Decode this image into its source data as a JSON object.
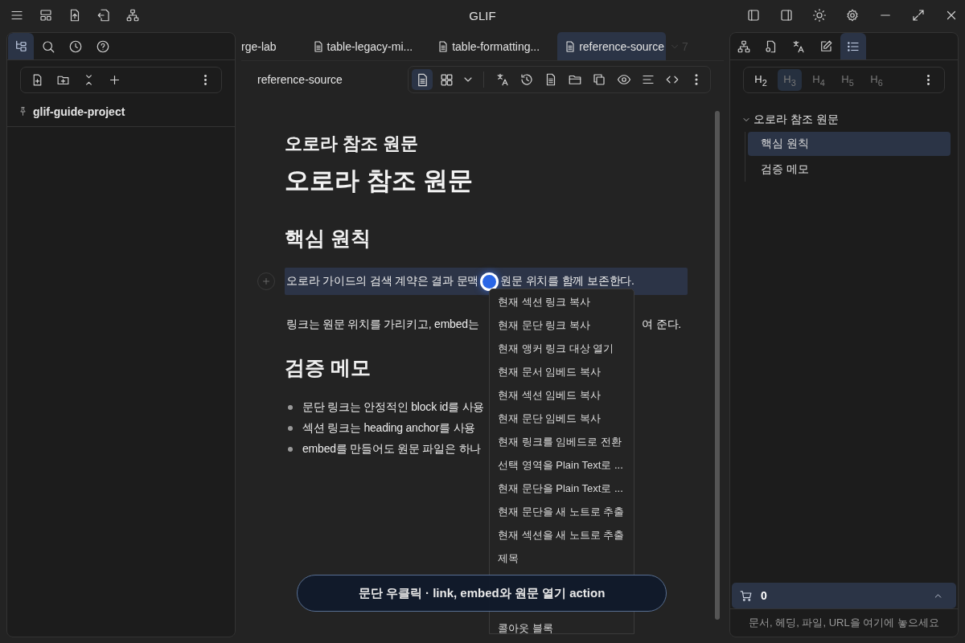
{
  "window": {
    "title": "GLIF"
  },
  "left_panel": {
    "tabs": [
      {
        "kind": "files",
        "selected": true
      },
      {
        "kind": "search",
        "selected": false
      },
      {
        "kind": "history",
        "selected": false
      },
      {
        "kind": "help",
        "selected": false
      }
    ],
    "project": "glif-guide-project"
  },
  "editor": {
    "tabs": [
      {
        "kind": "plain",
        "label": "rge-lab",
        "selected": false
      },
      {
        "kind": "document",
        "label": "table-legacy-mi...",
        "selected": false
      },
      {
        "kind": "document",
        "label": "table-formatting...",
        "selected": false
      },
      {
        "kind": "document",
        "label": "reference-source",
        "selected": true
      }
    ],
    "tab_count": "7",
    "doc_title": "reference-source",
    "view_modes": [
      {
        "kind": "document",
        "selected": true
      },
      {
        "kind": "grid",
        "selected": false
      }
    ],
    "blocks": [
      {
        "kind": "title",
        "text": "오로라 참조 원문"
      },
      {
        "kind": "h1",
        "text": "오로라 참조 원문"
      },
      {
        "kind": "h2",
        "text": "핵심 원칙"
      },
      {
        "kind": "paragraph",
        "text": "오로라 가이드의 검색 계약은 결과 문맥",
        "text_after": "원문 위치를 함께 보존한다.",
        "selected": true
      },
      {
        "kind": "split",
        "text": "링크는 원문 위치를 가리키고, embed는",
        "text_after": "여 준다."
      },
      {
        "kind": "h2",
        "text": "검증 메모"
      },
      {
        "kind": "list",
        "items": [
          "문단 링크는 안정적인 block id를 사용",
          "섹션 링크는 heading anchor를 사용",
          "embed를 만들어도 원문 파일은 하나"
        ]
      }
    ],
    "context_menu": [
      "현재 섹션 링크 복사",
      "현재 문단 링크 복사",
      "현재 앵커 링크 대상 열기",
      "현재 문서 임베드 복사",
      "현재 섹션 임베드 복사",
      "현재 문단 임베드 복사",
      "현재 링크를 임베드로 전환",
      "선택 영역을 Plain Text로 ...",
      "현재 문단을 Plain Text로 ...",
      "현재 문단을 새 노트로 추출",
      "현재 섹션을 새 노트로 추출",
      "제목",
      "콜아웃 블록"
    ],
    "toast": "문단 우클릭 · link, embed와 원문 열기 action"
  },
  "right_panel": {
    "tabs": [
      {
        "kind": "graph",
        "selected": false
      },
      {
        "kind": "file-link",
        "selected": false
      },
      {
        "kind": "translate",
        "selected": false
      },
      {
        "kind": "edit",
        "selected": false
      },
      {
        "kind": "outline",
        "selected": true
      }
    ],
    "heading_levels": [
      {
        "label": "H$_{2}$",
        "selected": false,
        "dimmed": false
      },
      {
        "label": "H$_{3}$",
        "selected": true,
        "dimmed": true
      },
      {
        "label": "H$_{4}$",
        "selected": false,
        "dimmed": true
      },
      {
        "label": "H$_{5}$",
        "selected": false,
        "dimmed": true
      },
      {
        "label": "H$_{6}$",
        "selected": false,
        "dimmed": true
      }
    ],
    "outline": [
      {
        "text": "오로라 참조 원문",
        "expanded": true,
        "children": [
          {
            "text": "핵심 원칙",
            "selected": true
          },
          {
            "text": "검증 메모",
            "selected": false
          }
        ]
      }
    ],
    "cart_count": "0",
    "drop_hint": "문서, 헤딩, 파일, URL을 여기에 놓으세요"
  }
}
